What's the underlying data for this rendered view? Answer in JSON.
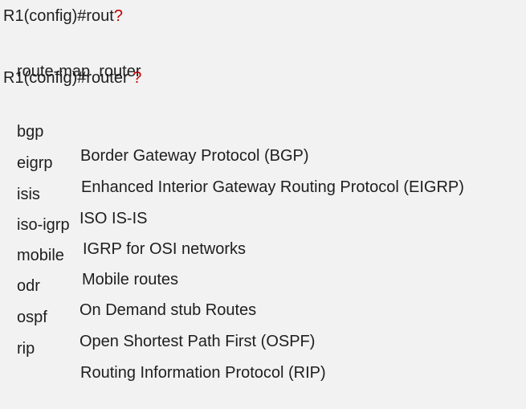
{
  "terminal": {
    "line1": {
      "prompt": "R1(config)#",
      "input": "rout",
      "help": "?"
    },
    "completion": "route-map  router",
    "line2": {
      "prompt": "R1(config)#",
      "input": "router ",
      "help": "?"
    },
    "commands": [
      {
        "keyword": "bgp",
        "description": "Border Gateway Protocol (BGP)"
      },
      {
        "keyword": "eigrp",
        "description": "Enhanced Interior Gateway Routing Protocol (EIGRP)"
      },
      {
        "keyword": "isis",
        "description": "ISO IS-IS"
      },
      {
        "keyword": "iso-igrp",
        "description": "IGRP for OSI networks"
      },
      {
        "keyword": "mobile",
        "description": "Mobile routes"
      },
      {
        "keyword": "odr",
        "description": "On Demand stub Routes"
      },
      {
        "keyword": "ospf",
        "description": "Open Shortest Path First (OSPF)"
      },
      {
        "keyword": "rip",
        "description": "Routing Information Protocol (RIP)"
      }
    ]
  }
}
